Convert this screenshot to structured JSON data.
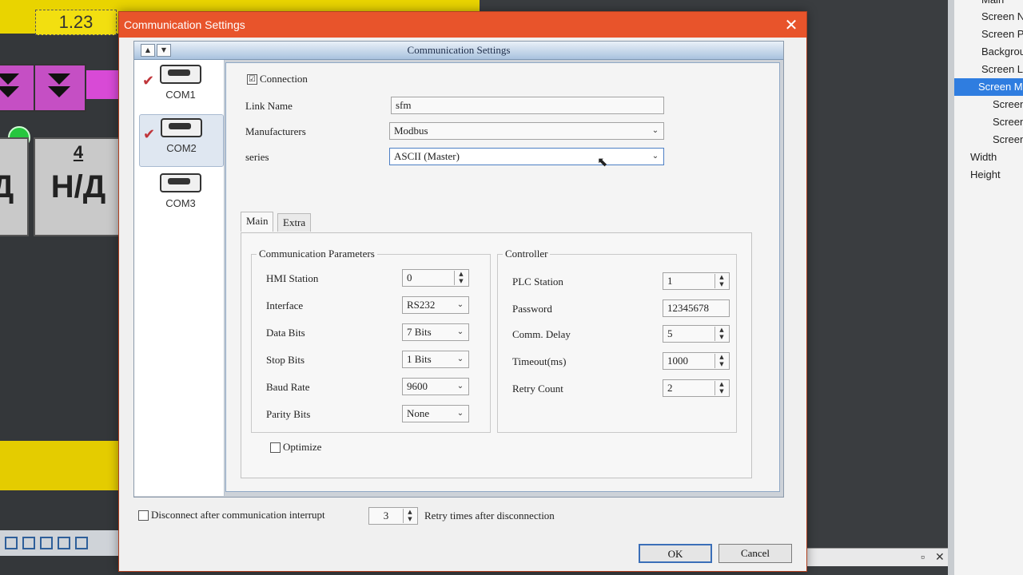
{
  "background": {
    "top_value": "1.23",
    "button_left": "Д",
    "button_right": "Н/Д",
    "button_right_number": "4",
    "right_panel_items": [
      "Main",
      "Screen Na",
      "Screen Pr",
      "Backgrou",
      "Screen Lo",
      "Screen M",
      "Screen",
      "Screen",
      "Screen",
      "Width",
      "Height"
    ]
  },
  "dialog": {
    "title": "Communication Settings",
    "inner_title": "Communication Settings",
    "close_label": "✕",
    "com_ports": [
      {
        "label": "COM1",
        "checked": true
      },
      {
        "label": "COM2",
        "checked": true,
        "selected": true
      },
      {
        "label": "COM3",
        "checked": false
      }
    ],
    "connection_label": "Connection",
    "connection_checked": "☑",
    "link_name_label": "Link Name",
    "link_name_value": "sfm",
    "manufacturers_label": "Manufacturers",
    "manufacturers_value": "Modbus",
    "series_label": "series",
    "series_value": "ASCII (Master)",
    "tabs": [
      "Main",
      "Extra"
    ],
    "comm_params": {
      "title": "Communication Parameters",
      "hmi_station_label": "HMI Station",
      "hmi_station_value": "0",
      "interface_label": "Interface",
      "interface_value": "RS232",
      "data_bits_label": "Data Bits",
      "data_bits_value": "7 Bits",
      "stop_bits_label": "Stop Bits",
      "stop_bits_value": "1 Bits",
      "baud_rate_label": "Baud Rate",
      "baud_rate_value": "9600",
      "parity_bits_label": "Parity Bits",
      "parity_bits_value": "None"
    },
    "controller": {
      "title": "Controller",
      "plc_station_label": "PLC Station",
      "plc_station_value": "1",
      "password_label": "Password",
      "password_value": "12345678",
      "comm_delay_label": "Comm. Delay",
      "comm_delay_value": "5",
      "timeout_label": "Timeout(ms)",
      "timeout_value": "1000",
      "retry_count_label": "Retry Count",
      "retry_count_value": "2"
    },
    "optimize_label": "Optimize",
    "disconnect_label": "Disconnect after communication interrupt",
    "retry_times_value": "3",
    "retry_times_label": "Retry times after disconnection",
    "ok_label": "OK",
    "cancel_label": "Cancel"
  }
}
